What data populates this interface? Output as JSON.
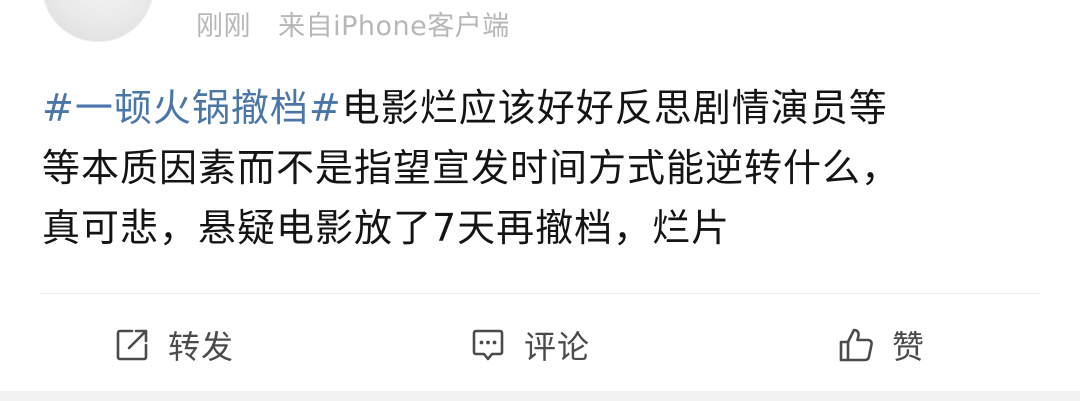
{
  "post_meta": {
    "time": "刚刚",
    "source": "来自iPhone客户端"
  },
  "post": {
    "hashtag": "#一顿火锅撤档#",
    "line1_rest": "电影烂应该好好反思剧情演员等",
    "line2": "等本质因素而不是指望宣发时间方式能逆转什么，",
    "line3": "真可悲，悬疑电影放了7天再撤档，烂片"
  },
  "actions": {
    "repost_label": "转发",
    "comment_label": "评论",
    "like_label": "赞"
  },
  "colors": {
    "hashtag": "#4a76a8",
    "meta_text": "#b7b7b7",
    "icon_stroke": "#4b4b4b"
  },
  "icons": [
    "avatar",
    "repost-icon",
    "comment-icon",
    "like-icon"
  ]
}
